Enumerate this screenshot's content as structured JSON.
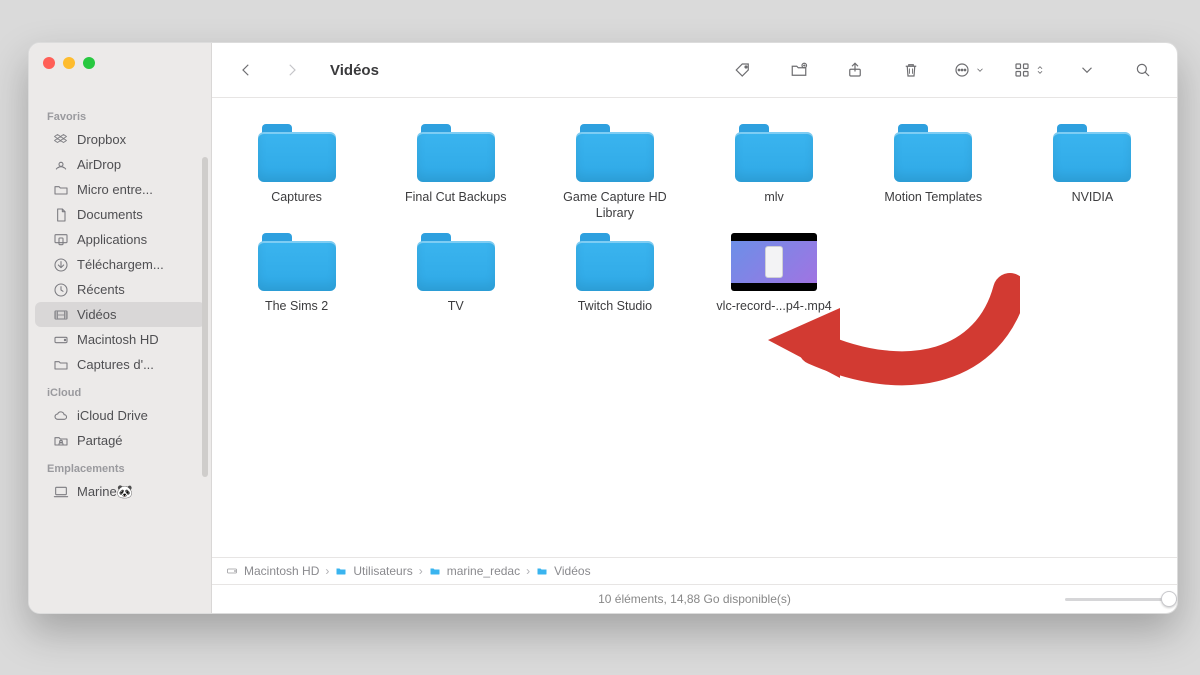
{
  "window": {
    "title": "Vidéos"
  },
  "sidebar": {
    "sections": [
      {
        "header": "Favoris",
        "items": [
          {
            "icon": "dropbox",
            "label": "Dropbox"
          },
          {
            "icon": "airdrop",
            "label": "AirDrop"
          },
          {
            "icon": "folder",
            "label": "Micro entre..."
          },
          {
            "icon": "doc",
            "label": "Documents"
          },
          {
            "icon": "apps",
            "label": "Applications"
          },
          {
            "icon": "download",
            "label": "Téléchargem..."
          },
          {
            "icon": "clock",
            "label": "Récents"
          },
          {
            "icon": "video",
            "label": "Vidéos",
            "selected": true
          },
          {
            "icon": "hd",
            "label": "Macintosh HD"
          },
          {
            "icon": "folder",
            "label": "Captures d'..."
          }
        ]
      },
      {
        "header": "iCloud",
        "items": [
          {
            "icon": "cloud",
            "label": "iCloud Drive"
          },
          {
            "icon": "shared",
            "label": "Partagé"
          }
        ]
      },
      {
        "header": "Emplacements",
        "items": [
          {
            "icon": "mac",
            "label": "Marine🐼"
          }
        ]
      }
    ]
  },
  "items": [
    {
      "type": "folder",
      "name": "Captures"
    },
    {
      "type": "folder",
      "name": "Final Cut Backups"
    },
    {
      "type": "folder",
      "name": "Game Capture HD Library"
    },
    {
      "type": "folder",
      "name": "mlv"
    },
    {
      "type": "folder",
      "name": "Motion Templates"
    },
    {
      "type": "folder",
      "name": "NVIDIA"
    },
    {
      "type": "folder",
      "name": "The Sims 2"
    },
    {
      "type": "folder",
      "name": "TV"
    },
    {
      "type": "folder",
      "name": "Twitch Studio"
    },
    {
      "type": "video",
      "name": "vlc-record-...p4-.mp4"
    }
  ],
  "path": [
    "Macintosh HD",
    "Utilisateurs",
    "marine_redac",
    "Vidéos"
  ],
  "status": "10 éléments, 14,88 Go disponible(s)"
}
